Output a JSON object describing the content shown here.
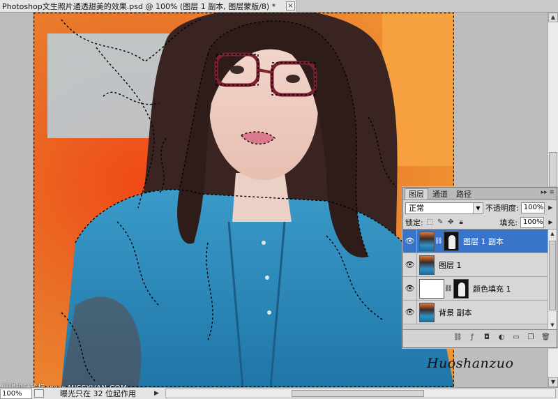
{
  "document": {
    "tab_title": "Photoshop文生照片通透甜美的效果.psd @ 100% (图层 1 副本, 图层蒙版/8) *",
    "close_glyph": "×"
  },
  "status_bar": {
    "zoom": "100%",
    "info": "曝光只在 32 位起作用"
  },
  "overlays": {
    "watermark": "思缘设计论坛 www.MISSYUAN.COM",
    "signature": "Huoshanzuo"
  },
  "layers_panel": {
    "tabs": [
      "图层",
      "通道",
      "路径"
    ],
    "blend_mode": "正常",
    "opacity_label": "不透明度:",
    "opacity_value": "100%",
    "lock_label": "锁定:",
    "fill_label": "填充:",
    "fill_value": "100%",
    "layers": [
      {
        "name": "图层 1 副本",
        "selected": true,
        "thumb": "photo",
        "mask": "mask-silhouette"
      },
      {
        "name": "图层 1",
        "selected": false,
        "thumb": "photo"
      },
      {
        "name": "颜色填充 1",
        "selected": false,
        "thumb": "white-fill",
        "mask": "mask-silhouette"
      },
      {
        "name": "背景 副本",
        "selected": false,
        "thumb": "photo"
      }
    ]
  },
  "colors": {
    "selection": "#3874c9",
    "panel_bg": "#d7d7d7",
    "canvas_bg": "#bdbdbd"
  }
}
